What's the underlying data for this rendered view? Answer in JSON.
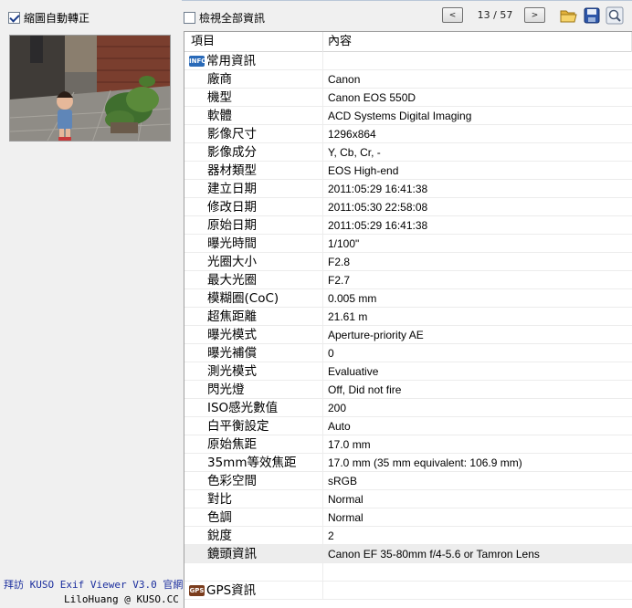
{
  "left_panel": {
    "auto_rotate_label": "縮圖自動轉正",
    "auto_rotate_checked": true,
    "credit_line1": "拜訪 KUSO Exif Viewer V3.0 官網",
    "credit_line2": "LiloHuang @ KUSO.CC"
  },
  "toolbar": {
    "show_all_label": "檢視全部資訊",
    "show_all_checked": false,
    "prev_label": "<",
    "next_label": ">",
    "counter": "13 / 57"
  },
  "table": {
    "col_item": "項目",
    "col_content": "內容",
    "general_group": "常用資訊",
    "general_group_icon": "INFO",
    "rows": [
      {
        "item": "廠商",
        "value": "Canon"
      },
      {
        "item": "機型",
        "value": "Canon EOS 550D"
      },
      {
        "item": "軟體",
        "value": "ACD Systems Digital Imaging"
      },
      {
        "item": "影像尺寸",
        "value": "1296x864"
      },
      {
        "item": "影像成分",
        "value": "Y, Cb, Cr, -"
      },
      {
        "item": "器材類型",
        "value": "EOS High-end"
      },
      {
        "item": "建立日期",
        "value": "2011:05:29 16:41:38"
      },
      {
        "item": "修改日期",
        "value": "2011:05:30 22:58:08"
      },
      {
        "item": "原始日期",
        "value": "2011:05:29 16:41:38"
      },
      {
        "item": "曝光時間",
        "value": "1/100\""
      },
      {
        "item": "光圈大小",
        "value": "F2.8"
      },
      {
        "item": "最大光圈",
        "value": "F2.7"
      },
      {
        "item": "模糊圈(CoC)",
        "value": "0.005 mm"
      },
      {
        "item": "超焦距離",
        "value": "21.61 m"
      },
      {
        "item": "曝光模式",
        "value": "Aperture-priority AE"
      },
      {
        "item": "曝光補償",
        "value": "0"
      },
      {
        "item": "測光模式",
        "value": "Evaluative"
      },
      {
        "item": "閃光燈",
        "value": "Off, Did not fire"
      },
      {
        "item": "ISO感光數值",
        "value": "200"
      },
      {
        "item": "白平衡設定",
        "value": "Auto"
      },
      {
        "item": "原始焦距",
        "value": "17.0 mm"
      },
      {
        "item": "35mm等效焦距",
        "value": "17.0 mm (35 mm equivalent: 106.9 mm)"
      },
      {
        "item": "色彩空間",
        "value": "sRGB"
      },
      {
        "item": "對比",
        "value": "Normal"
      },
      {
        "item": "色調",
        "value": "Normal"
      },
      {
        "item": "銳度",
        "value": "2"
      },
      {
        "item": "鏡頭資訊",
        "value": "Canon EF 35-80mm f/4-5.6 or Tamron Lens"
      }
    ],
    "gps_group": "GPS資訊",
    "gps_group_icon": "GPS"
  },
  "colors": {
    "accent_blue": "#1c2f9e",
    "info_icon": "#2a6ab8",
    "gps_icon": "#7a3c1c"
  },
  "icons": [
    "open-folder-icon",
    "save-icon",
    "zoom-icon"
  ]
}
